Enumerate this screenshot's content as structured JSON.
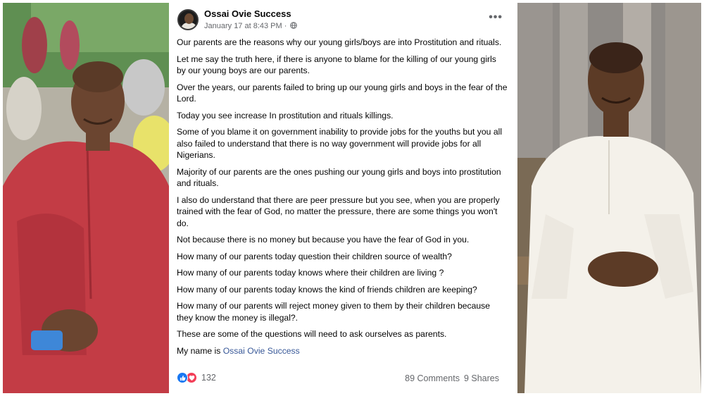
{
  "post": {
    "author": "Ossai Ovie Success",
    "timestamp": "January 17 at 8:43 PM",
    "privacy_icon": "globe-icon",
    "more_label": "•••",
    "paragraphs": [
      "Our parents are the reasons why our young girls/boys are into Prostitution and rituals.",
      "Let me say the truth here, if there is anyone to blame for the killing of our young girls by our young boys are our parents.",
      "Over the years, our parents failed to bring up our young girls and boys in the fear of the Lord.",
      "Today you see increase In prostitution and rituals killings.",
      "Some of you blame it on government inability to provide jobs for the youths but you all also failed to understand that there is no way government will provide jobs for all Nigerians.",
      "Majority of our parents are the ones pushing our young girls and boys into prostitution and rituals.",
      "I also do understand that there are peer pressure but you see, when you are properly trained with the fear of God, no matter the pressure, there are some things you won't do.",
      "Not because there is no money but because you have the fear of God in you.",
      "How many of our parents today question their children source of wealth?",
      "How many of our parents today knows where their children are living ?",
      "How many of our parents today knows the kind of friends children are keeping?",
      "How many of our parents will reject money given to them by their children because they know the money is illegal?.",
      "These are some of the questions will need to ask ourselves as parents."
    ],
    "signature_prefix": "My name is ",
    "signature_link": "Ossai Ovie Success",
    "reaction_count": "132",
    "comments": "89 Comments",
    "shares": "9 Shares"
  },
  "colors": {
    "link": "#385898",
    "like": "#1877f2",
    "love": "#f33e58",
    "meta": "#65676b"
  }
}
